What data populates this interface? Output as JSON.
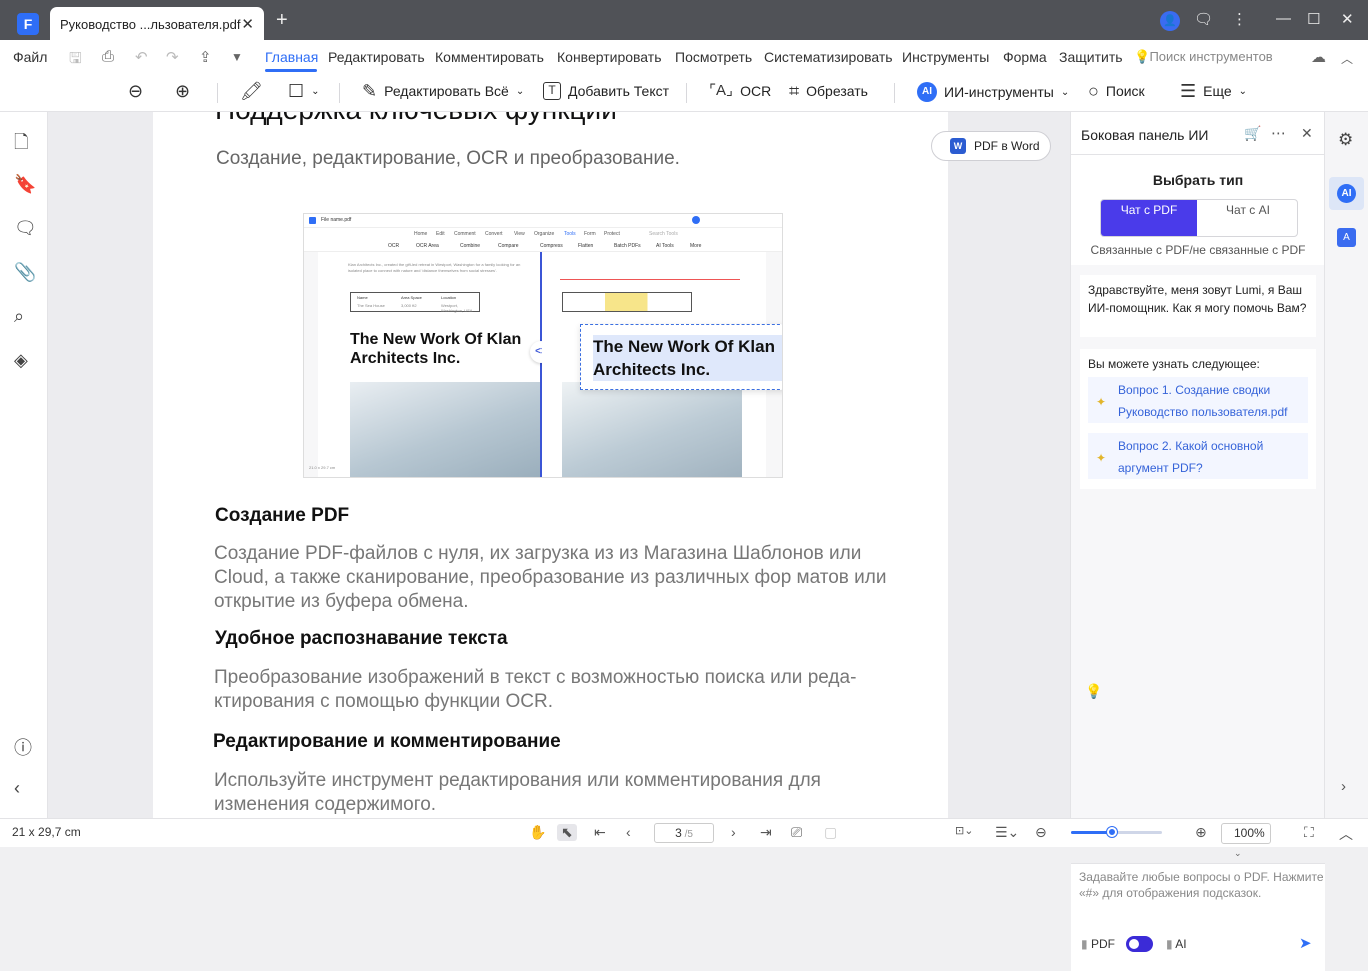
{
  "titlebar": {
    "tab_title": "Руководство ...льзователя.pdf",
    "logo": "F"
  },
  "menubar": {
    "file": "Файл",
    "tabs": [
      "Главная",
      "Редактировать",
      "Комментировать",
      "Конвертировать",
      "Посмотреть",
      "Систематизировать",
      "Инструменты",
      "Форма",
      "Защитить"
    ],
    "tool_search_placeholder": "Поиск инструментов"
  },
  "toolbar": {
    "edit_all": "Редактировать Всё",
    "add_text": "Добавить Текст",
    "ocr": "OCR",
    "crop": "Обрезать",
    "ai_tools": "ИИ-инструменты",
    "search": "Поиск",
    "more": "Еще"
  },
  "document": {
    "heading_top": "Поддержка ключевых функций",
    "subtitle": "Создание, редактирование, OCR и преобразование.",
    "section1_title": "Создание PDF",
    "section1_text": "Создание PDF-файлов с нуля, их загрузка из из Магазина Шаблонов или Cloud, а также сканирование, преобразование из различных фор матов или открытие из буфера обмена.",
    "section2_title": "Удобное распознавание текста",
    "section2_text": "Преобразование изображений в текст с возможностью поиска или реда- ктирования с помощью функции OCR.",
    "section3_title": "Редактирование и комментирование",
    "section3_text": "Используйте инструмент редактирования или комментирования для изменения содержимого.",
    "pdf_to_word": "PDF в Word",
    "screenshot": {
      "file_tab": "File name.pdf",
      "menu": [
        "Home",
        "Edit",
        "Comment",
        "Convert",
        "View",
        "Organize",
        "Tools",
        "Form",
        "Protect"
      ],
      "search_tools": "Search Tools",
      "tools": [
        "OCR",
        "OCR Area",
        "Combine",
        "Compare",
        "Compress",
        "Flatten",
        "Batch PDFs",
        "AI Tools",
        "More"
      ],
      "body_text": "Klan Architects Inc., created the gift-led retreat in Westport, Washington for a family looking for an isolated place to connect with nature and 'distance themselves from social stresses'.",
      "table_headers": [
        "Name",
        "Area Space",
        "Location"
      ],
      "table_values": [
        "The Sea House",
        "3,000 ft2",
        "Westport, Washington, USA"
      ],
      "headline": "The New Work Of Klan Architects Inc.",
      "page_info": "21.0 x 29.7 cm"
    }
  },
  "ai_panel": {
    "title": "Боковая панель ИИ",
    "choose_type": "Выбрать тип",
    "option_pdf": "Чат с PDF",
    "option_ai": "Чат с AI",
    "note": "Связанные с PDF/не связанные с PDF",
    "greeting": "Здравствуйте, меня зовут Lumi, я Ваш ИИ-помощник. Как я могу помочь Вам?",
    "learn_title": "Вы можете узнать следующее:",
    "q1": "Вопрос 1. Создание сводки Руководство пользователя.pdf",
    "q2": "Вопрос 2. Какой основной аргумент PDF?",
    "input_placeholder": "Задавайте любые вопросы о PDF. Нажмите «#» для отображения подсказок.",
    "pdf_label": "PDF",
    "ai_label": "AI"
  },
  "statusbar": {
    "page_size": "21 x 29,7 cm",
    "current_page": "3",
    "total_pages": "/5",
    "zoom": "100%",
    "zoom_level": 0.45
  },
  "colors": {
    "accent": "#2f6ef6",
    "ai_purple": "#4a3bea",
    "titlebar": "#505257"
  }
}
